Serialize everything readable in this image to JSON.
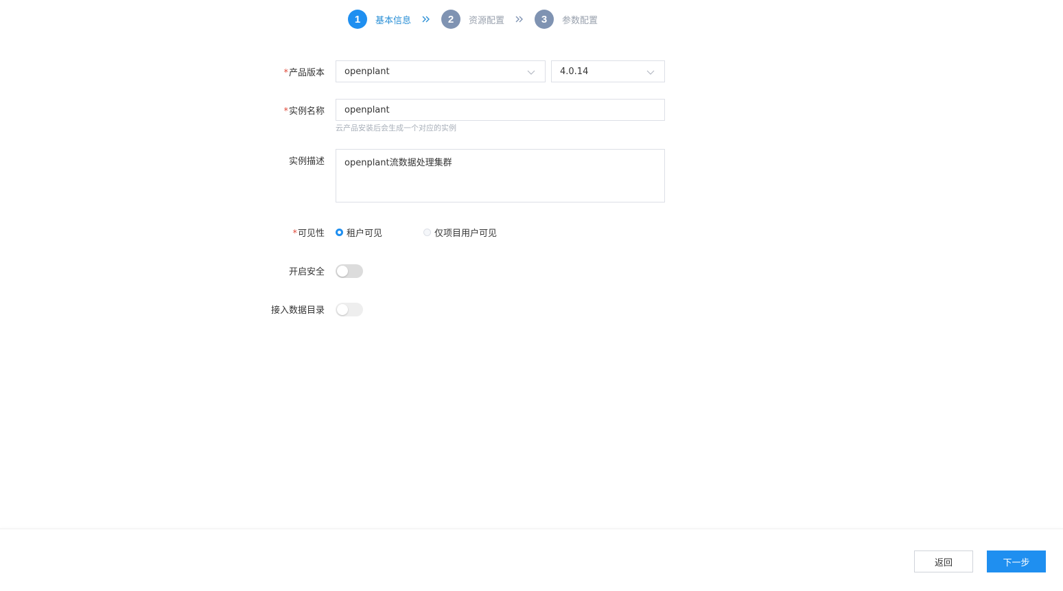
{
  "steps": [
    {
      "number": "1",
      "label": "基本信息",
      "state": "active"
    },
    {
      "number": "2",
      "label": "资源配置",
      "state": "inactive"
    },
    {
      "number": "3",
      "label": "参数配置",
      "state": "inactive"
    }
  ],
  "form": {
    "product_version": {
      "label": "产品版本",
      "required_mark": "*",
      "product_value": "openplant",
      "version_value": "4.0.14"
    },
    "instance_name": {
      "label": "实例名称",
      "required_mark": "*",
      "value": "openplant",
      "hint": "云产品安装后会生成一个对应的实例"
    },
    "instance_desc": {
      "label": "实例描述",
      "value": "openplant流数据处理集群"
    },
    "visibility": {
      "label": "可见性",
      "required_mark": "*",
      "options": [
        {
          "label": "租户可见",
          "checked": true
        },
        {
          "label": "仅项目用户可见",
          "checked": false
        }
      ]
    },
    "enable_security": {
      "label": "开启安全",
      "on": false
    },
    "data_catalog": {
      "label": "接入数据目录",
      "on": false,
      "disabled": true
    }
  },
  "footer": {
    "back_label": "返回",
    "next_label": "下一步"
  },
  "colors": {
    "primary": "#1f8ff0",
    "step_inactive": "#7f93b2",
    "required": "#e04a3a"
  }
}
